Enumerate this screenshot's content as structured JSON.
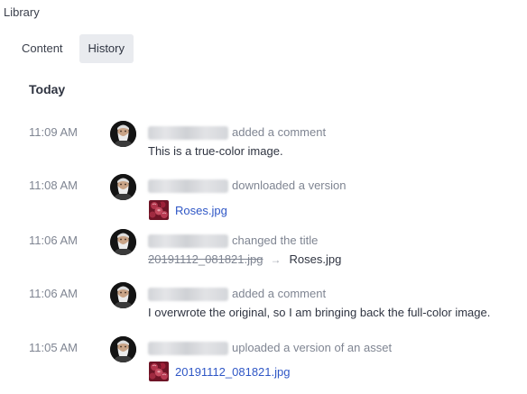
{
  "breadcrumb": {
    "label": "Library"
  },
  "tabs": [
    {
      "label": "Content",
      "active": false
    },
    {
      "label": "History",
      "active": true
    }
  ],
  "day_heading": "Today",
  "entries": [
    {
      "time": "11:09 AM",
      "action": "added a comment",
      "comment": "This is a true-color image."
    },
    {
      "time": "11:08 AM",
      "action": "downloaded a version",
      "file": "Roses.jpg"
    },
    {
      "time": "11:06 AM",
      "action": "changed the title",
      "old_title": "20191112_081821.jpg",
      "arrow": "→",
      "new_title": "Roses.jpg"
    },
    {
      "time": "11:06 AM",
      "action": "added a comment",
      "comment": "I overwrote the original, so I am bringing back the full-color image."
    },
    {
      "time": "11:05 AM",
      "action": "uploaded a version of an asset",
      "file": "20191112_081821.jpg"
    }
  ],
  "colors": {
    "link": "#2f57c6",
    "muted_text": "#7f8592",
    "active_tab_bg": "#e9ebef"
  },
  "icons": {
    "avatar": "bearded-man-photo",
    "file_thumbnail": "roses-image-thumbnail",
    "title_change_arrow": "right-arrow-icon"
  }
}
